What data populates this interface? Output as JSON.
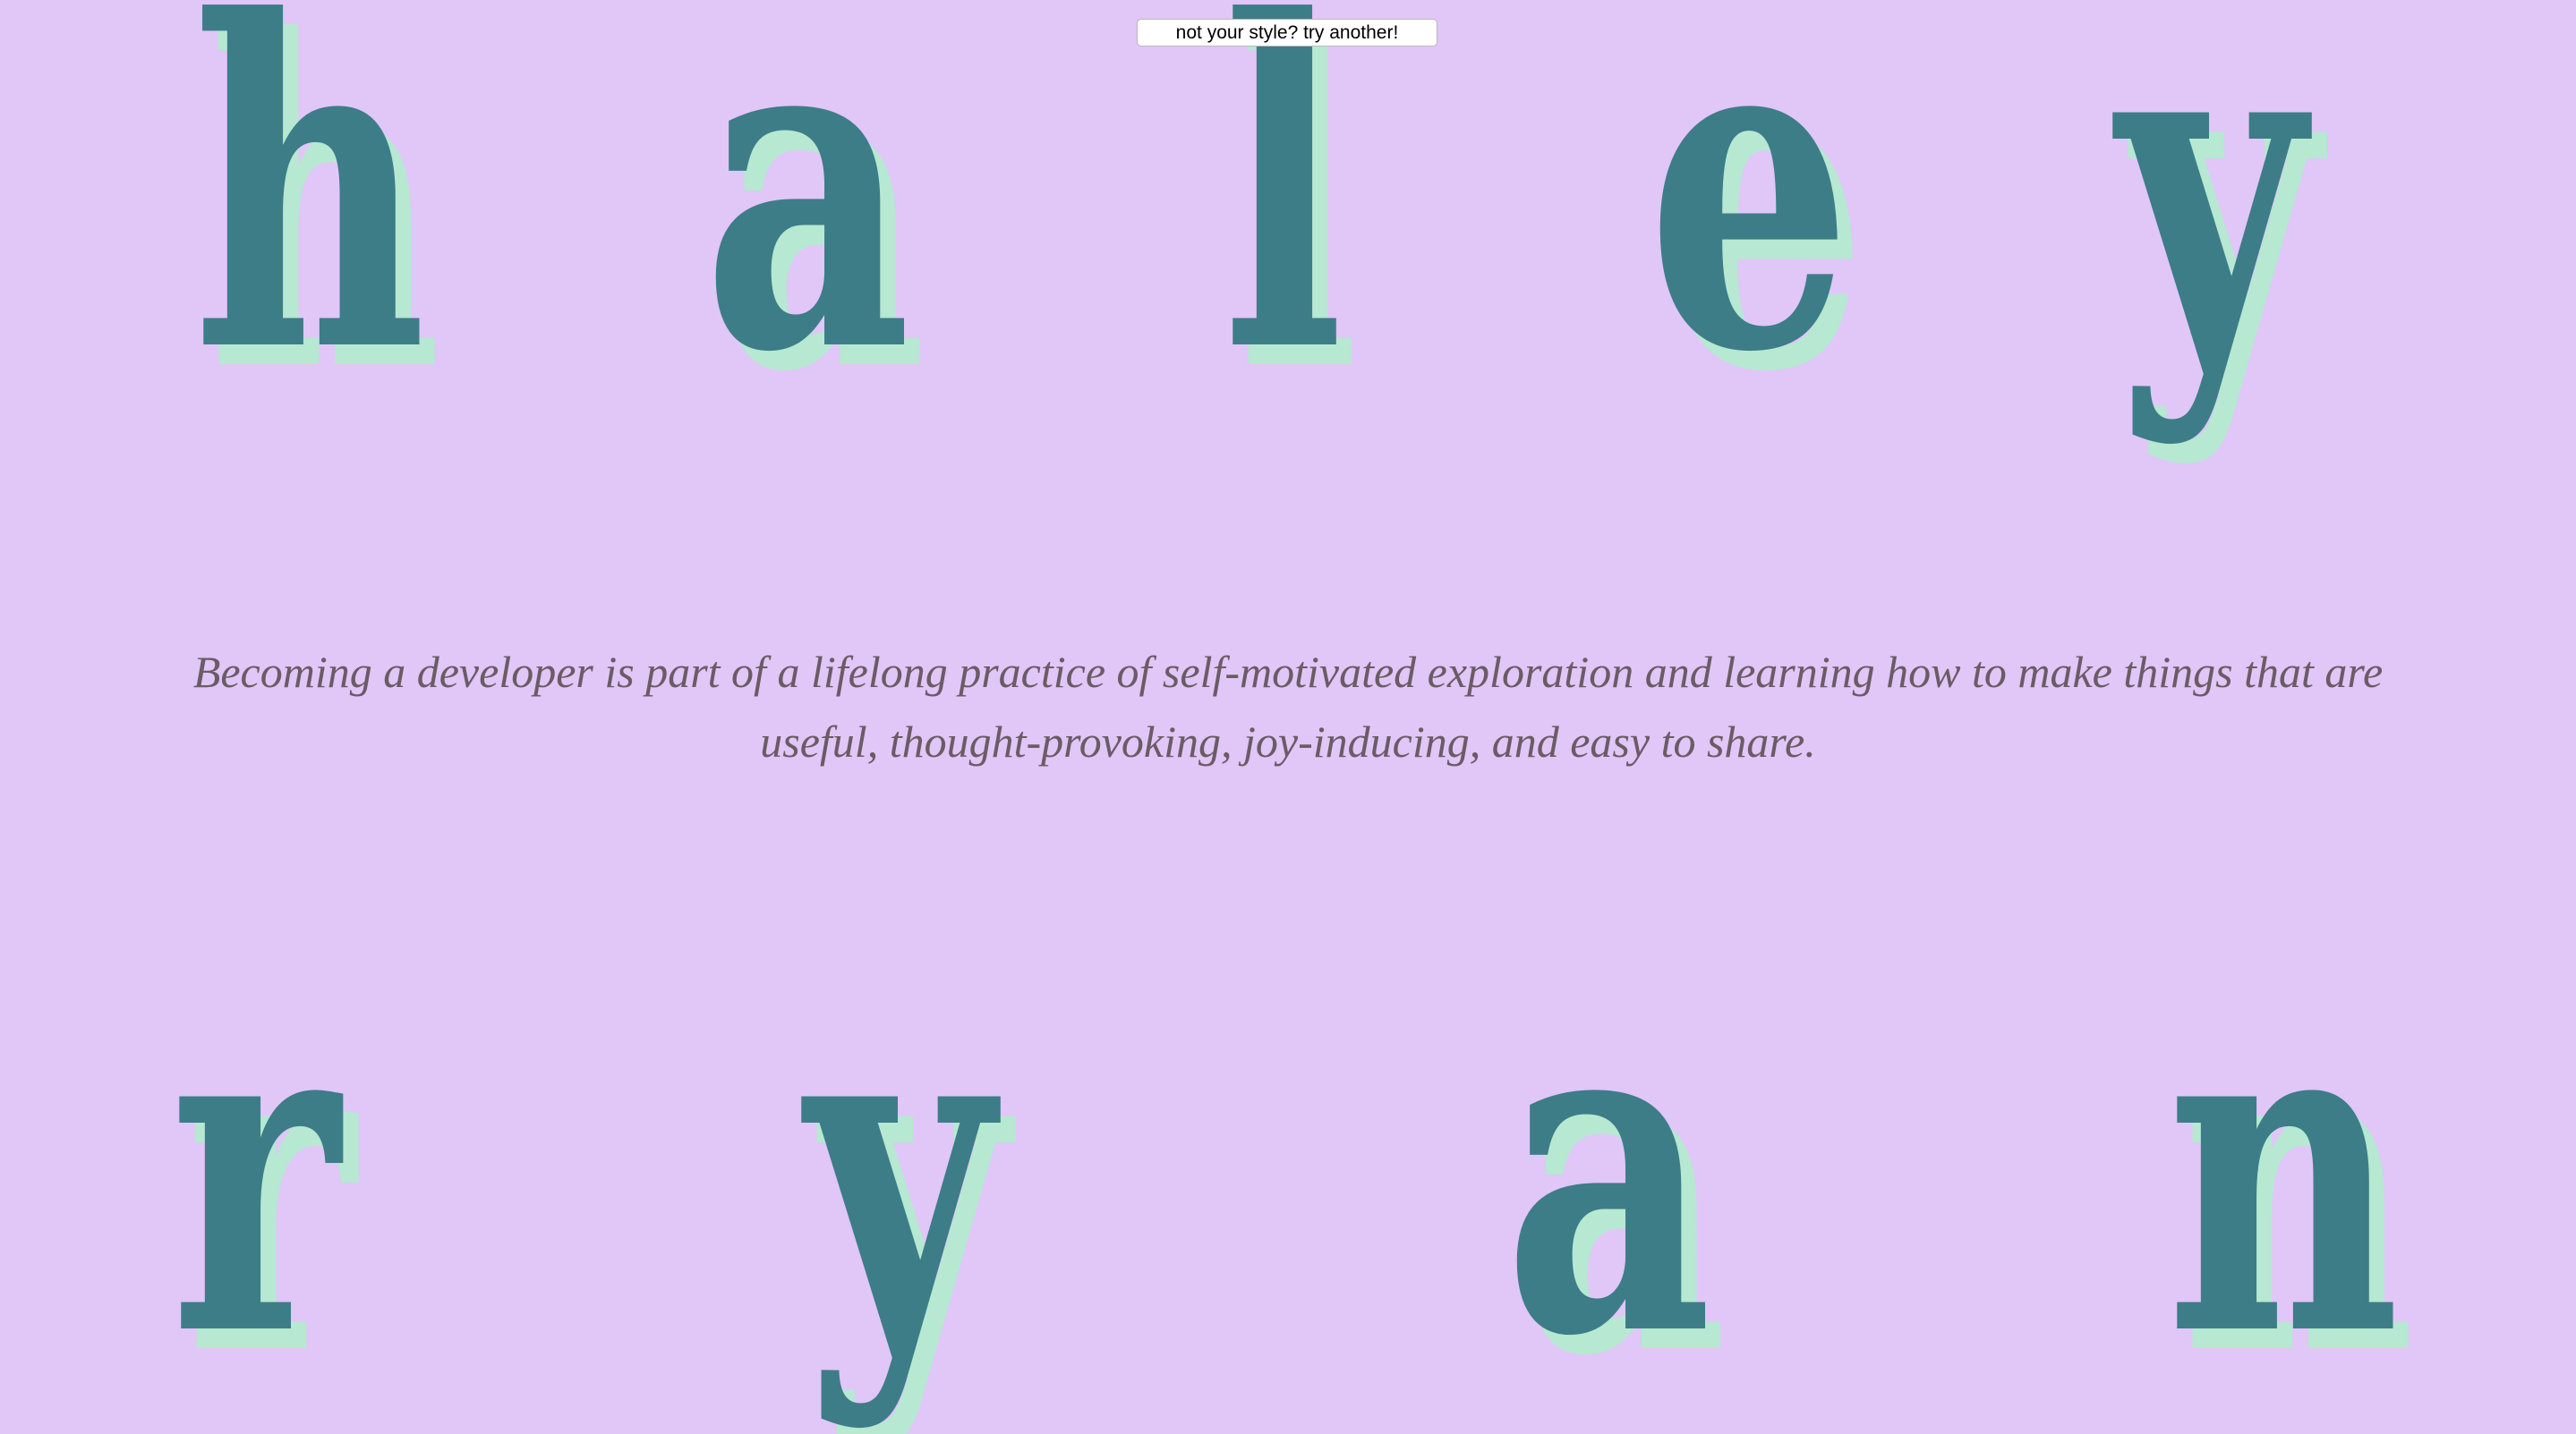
{
  "page": {
    "background_color": "#e1c6f8",
    "letter_color": "#3c7d88",
    "letter_shadow_color": "#b6e8d2"
  },
  "style_button": {
    "label": "not your style? try another!"
  },
  "name": {
    "first": [
      "h",
      "a",
      "l",
      "e",
      "y"
    ],
    "last": [
      "r",
      "y",
      "a",
      "n"
    ]
  },
  "tagline": "Becoming a developer is part of a lifelong practice of self-motivated exploration and learning how to make things that are useful, thought-provoking, joy-inducing, and easy to share."
}
